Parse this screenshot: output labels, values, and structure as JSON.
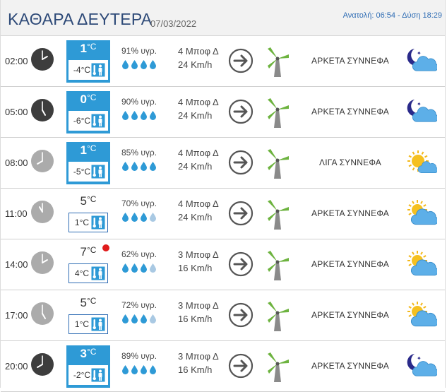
{
  "header": {
    "title": "ΚΑΘΑΡΑ ΔΕΥΤΕΡΑ",
    "date": "07/03/2022",
    "sun": "Ανατολή: 06:54 - Δύση 18:29"
  },
  "colors": {
    "accent": "#2e9ad6",
    "title": "#2e4a78",
    "drop_full": "#2e9ad6",
    "drop_empty": "#a9c9e3",
    "hot": "#e01b1b"
  },
  "rows": [
    {
      "time": "02:00",
      "clock": "dark",
      "hour": 2,
      "temp": "1",
      "filled": true,
      "feels": "-4°C",
      "hum": "91% υγρ.",
      "drops": 4,
      "wind_bf": "4 Μποφ Δ",
      "wind_kmh": "24 Km/h",
      "desc": "ΑΡΚΕΤΑ ΣΥΝΝΕΦΑ",
      "icon": "moon-cloud-icon"
    },
    {
      "time": "05:00",
      "clock": "dark",
      "hour": 5,
      "temp": "0",
      "filled": true,
      "feels": "-6°C",
      "hum": "90% υγρ.",
      "drops": 4,
      "wind_bf": "4 Μποφ Δ",
      "wind_kmh": "24 Km/h",
      "desc": "ΑΡΚΕΤΑ ΣΥΝΝΕΦΑ",
      "icon": "moon-cloud-icon"
    },
    {
      "time": "08:00",
      "clock": "light",
      "hour": 8,
      "temp": "1",
      "filled": true,
      "feels": "-5°C",
      "hum": "85% υγρ.",
      "drops": 4,
      "wind_bf": "4 Μποφ Δ",
      "wind_kmh": "24 Km/h",
      "desc": "ΛΙΓΑ ΣΥΝΝΕΦΑ",
      "icon": "sun-small-cloud-icon"
    },
    {
      "time": "11:00",
      "clock": "light",
      "hour": 11,
      "temp": "5",
      "filled": false,
      "feels": "1°C",
      "hum": "70% υγρ.",
      "drops": 3,
      "wind_bf": "4 Μποφ Δ",
      "wind_kmh": "24 Km/h",
      "desc": "ΑΡΚΕΤΑ ΣΥΝΝΕΦΑ",
      "icon": "sun-cloud-icon"
    },
    {
      "time": "14:00",
      "clock": "light",
      "hour": 2,
      "temp": "7",
      "filled": false,
      "hot": true,
      "feels": "4°C",
      "hum": "62% υγρ.",
      "drops": 3,
      "wind_bf": "3 Μποφ Δ",
      "wind_kmh": "16 Km/h",
      "desc": "ΑΡΚΕΤΑ ΣΥΝΝΕΦΑ",
      "icon": "sun-cloud-icon"
    },
    {
      "time": "17:00",
      "clock": "light",
      "hour": 5,
      "temp": "5",
      "filled": false,
      "feels": "1°C",
      "hum": "72% υγρ.",
      "drops": 3,
      "wind_bf": "3 Μποφ Δ",
      "wind_kmh": "16 Km/h",
      "desc": "ΑΡΚΕΤΑ ΣΥΝΝΕΦΑ",
      "icon": "sun-cloud-icon"
    },
    {
      "time": "20:00",
      "clock": "dark",
      "hour": 8,
      "temp": "3",
      "filled": true,
      "feels": "-2°C",
      "hum": "89% υγρ.",
      "drops": 4,
      "wind_bf": "3 Μποφ Δ",
      "wind_kmh": "16 Km/h",
      "desc": "ΑΡΚΕΤΑ ΣΥΝΝΕΦΑ",
      "icon": "moon-cloud-icon"
    }
  ],
  "unit": "°C"
}
